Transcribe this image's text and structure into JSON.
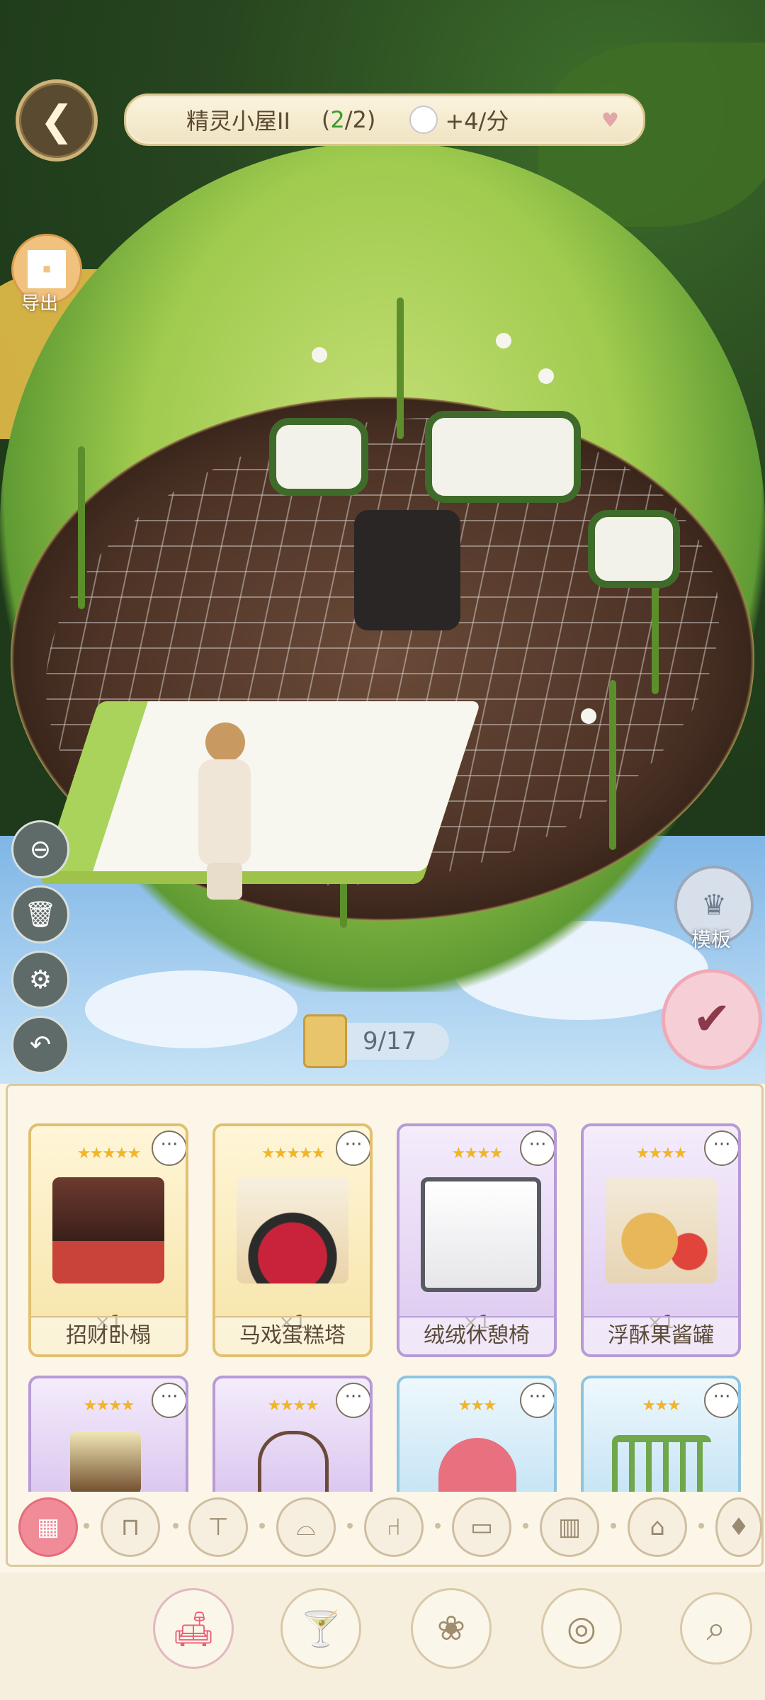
{
  "header": {
    "title": "精灵小屋II",
    "count_open": "(",
    "count_current": "2",
    "count_rest": "/2)",
    "rate": "+4/分"
  },
  "export_label": "导出",
  "template_label": "模板",
  "capacity": "9/17",
  "side_tools": [
    "minus-circle-icon",
    "trash-icon",
    "gear-icon",
    "undo-icon"
  ],
  "items": [
    {
      "name": "招财卧榻",
      "qty": "×1",
      "stars": "★★★★★",
      "tier": "gold"
    },
    {
      "name": "马戏蛋糕塔",
      "qty": "×1",
      "stars": "★★★★★",
      "tier": "gold"
    },
    {
      "name": "绒绒休憩椅",
      "qty": "×1",
      "stars": "★★★★",
      "tier": "purple"
    },
    {
      "name": "浮酥果酱罐",
      "qty": "×1",
      "stars": "★★★★",
      "tier": "purple"
    },
    {
      "stars": "★★★★",
      "tier": "purple"
    },
    {
      "stars": "★★★★",
      "tier": "purple"
    },
    {
      "stars": "★★★",
      "tier": "blue"
    },
    {
      "stars": "★★★",
      "tier": "blue"
    }
  ],
  "more_glyph": "···",
  "categories": [
    "all-icon",
    "table-icon",
    "round-table-icon",
    "sofa-icon",
    "chair-icon",
    "bed-icon",
    "cabinet-icon",
    "fireplace-icon",
    "lamp-icon"
  ],
  "bottom_nav": [
    "furniture-icon",
    "cocktail-icon",
    "plant-vase-icon",
    "planet-icon",
    "search-icon"
  ]
}
